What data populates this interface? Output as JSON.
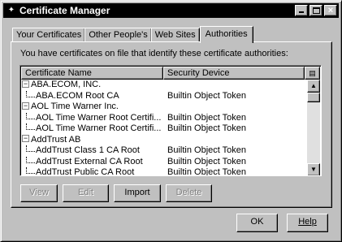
{
  "window": {
    "title": "Certificate Manager",
    "title_icon": "certificate-icon"
  },
  "tabs": [
    {
      "label": "Your Certificates",
      "active": false
    },
    {
      "label": "Other People's",
      "active": false
    },
    {
      "label": "Web Sites",
      "active": false
    },
    {
      "label": "Authorities",
      "active": true
    }
  ],
  "panel": {
    "description": "You have certificates on file that identify these certificate authorities:",
    "columns": {
      "name": "Certificate Name",
      "device": "Security Device"
    },
    "rows": [
      {
        "type": "group",
        "name": "ABA.ECOM, INC.",
        "device": "",
        "expander": "−"
      },
      {
        "type": "child",
        "name": "ABA.ECOM Root CA",
        "device": "Builtin Object Token"
      },
      {
        "type": "group",
        "name": "AOL Time Warner Inc.",
        "device": "",
        "expander": "−"
      },
      {
        "type": "child",
        "name": "AOL Time Warner Root Certifi...",
        "device": "Builtin Object Token"
      },
      {
        "type": "child",
        "name": "AOL Time Warner Root Certifi...",
        "device": "Builtin Object Token"
      },
      {
        "type": "group",
        "name": "AddTrust AB",
        "device": "",
        "expander": "−"
      },
      {
        "type": "child",
        "name": "AddTrust Class 1 CA Root",
        "device": "Builtin Object Token"
      },
      {
        "type": "child",
        "name": "AddTrust External CA Root",
        "device": "Builtin Object Token"
      },
      {
        "type": "child",
        "name": "AddTrust Public CA Root",
        "device": "Builtin Object Token"
      }
    ],
    "buttons": {
      "view": "View",
      "edit": "Edit",
      "import": "Import",
      "delete": "Delete"
    }
  },
  "dialog": {
    "ok": "OK",
    "help": "Help"
  }
}
